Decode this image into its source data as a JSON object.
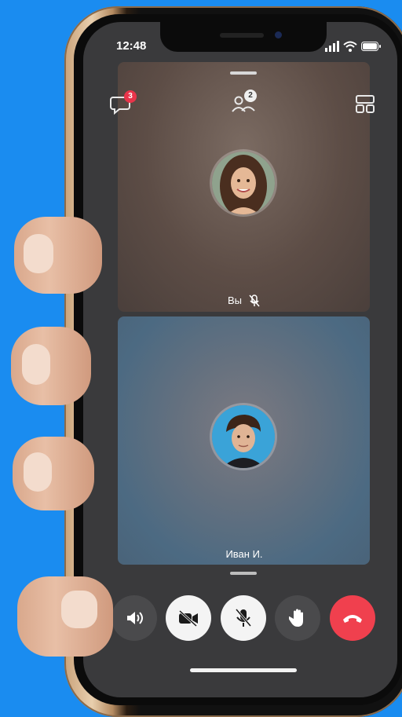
{
  "status_bar": {
    "time": "12:48"
  },
  "header": {
    "chat_badge": "3",
    "participants_badge": "2"
  },
  "tiles": {
    "self_label": "Вы",
    "other_label": "Иван И."
  },
  "controls": [
    "speaker",
    "camera-off",
    "mic-off",
    "raise-hand",
    "end-call"
  ],
  "colors": {
    "background": "#1a8cf0",
    "end_call": "#f0404e",
    "badge": "#e8344a"
  }
}
